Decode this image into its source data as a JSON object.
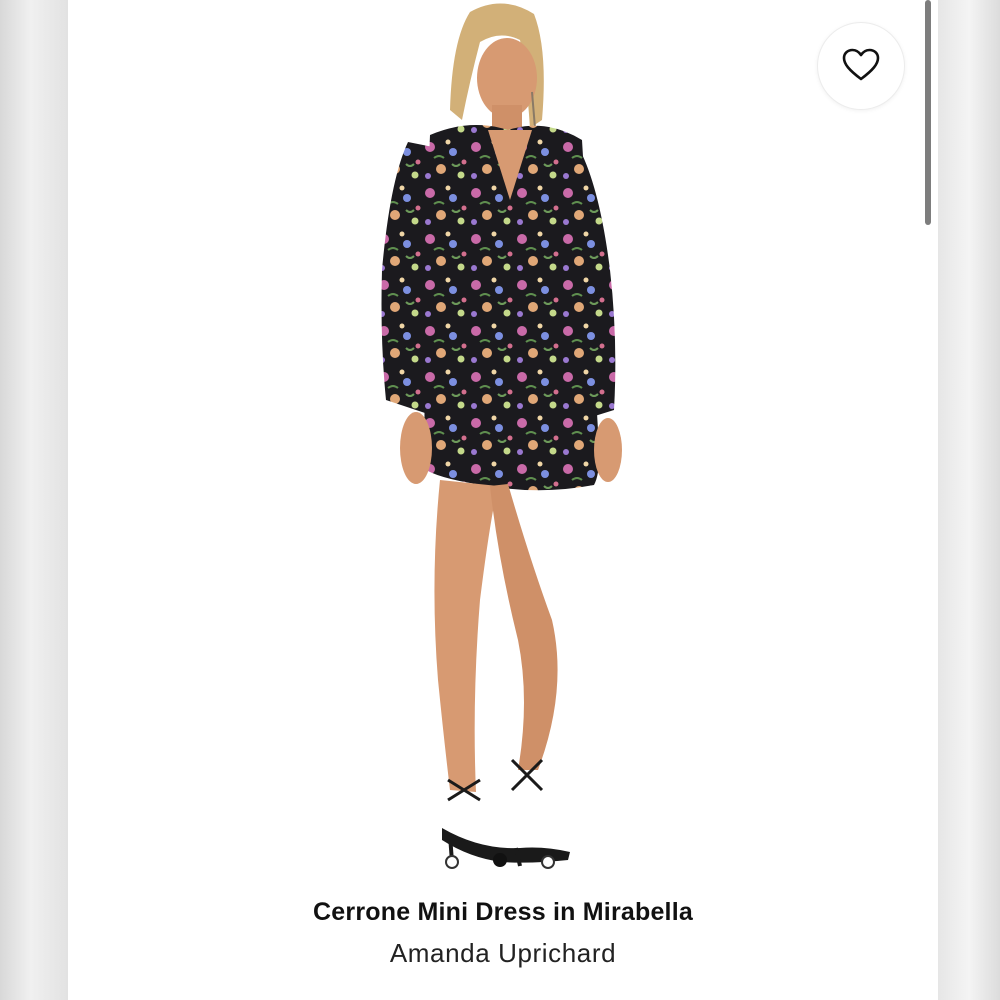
{
  "product": {
    "name": "Cerrone Mini Dress in Mirabella",
    "brand": "Amanda Uprichard"
  },
  "icons": {
    "favorite": "heart-outline-icon"
  },
  "colors": {
    "dress": "#1b1a1e",
    "skin": "#d79a72",
    "hair": "#d2b078",
    "text": "#111111"
  }
}
